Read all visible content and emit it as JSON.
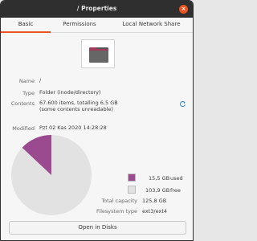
{
  "window": {
    "title": "/ Properties",
    "close_label": "×"
  },
  "tabs": [
    {
      "label": "Basic"
    },
    {
      "label": "Permissions"
    },
    {
      "label": "Local Network Share"
    }
  ],
  "properties": {
    "name_label": "Name",
    "name_value": "/",
    "type_label": "Type",
    "type_value": "Folder (inode/directory)",
    "contents_label": "Contents",
    "contents_line1": "67.600 items, totalling 6,5 GB",
    "contents_line2": "(some contents unreadable)",
    "modified_label": "Modified",
    "modified_value": "Pzt 02 Kas 2020 14:28:28"
  },
  "disk_usage": {
    "used_fraction": 0.1299,
    "used_color": "#9b4a8f",
    "free_color": "#e2e2e2",
    "used_value": "15,5 GB",
    "used_label": "used",
    "free_value": "103,9 GB",
    "free_label": "free",
    "total_capacity_label": "Total capacity",
    "total_capacity_value": "125,8 GB",
    "filesystem_type_label": "Filesystem type",
    "filesystem_type_value": "ext3/ext4"
  },
  "actions": {
    "open_in_disks": "Open in Disks"
  },
  "icons": {
    "folder": "folder-icon",
    "refresh": "refresh-icon",
    "close": "close-icon"
  }
}
